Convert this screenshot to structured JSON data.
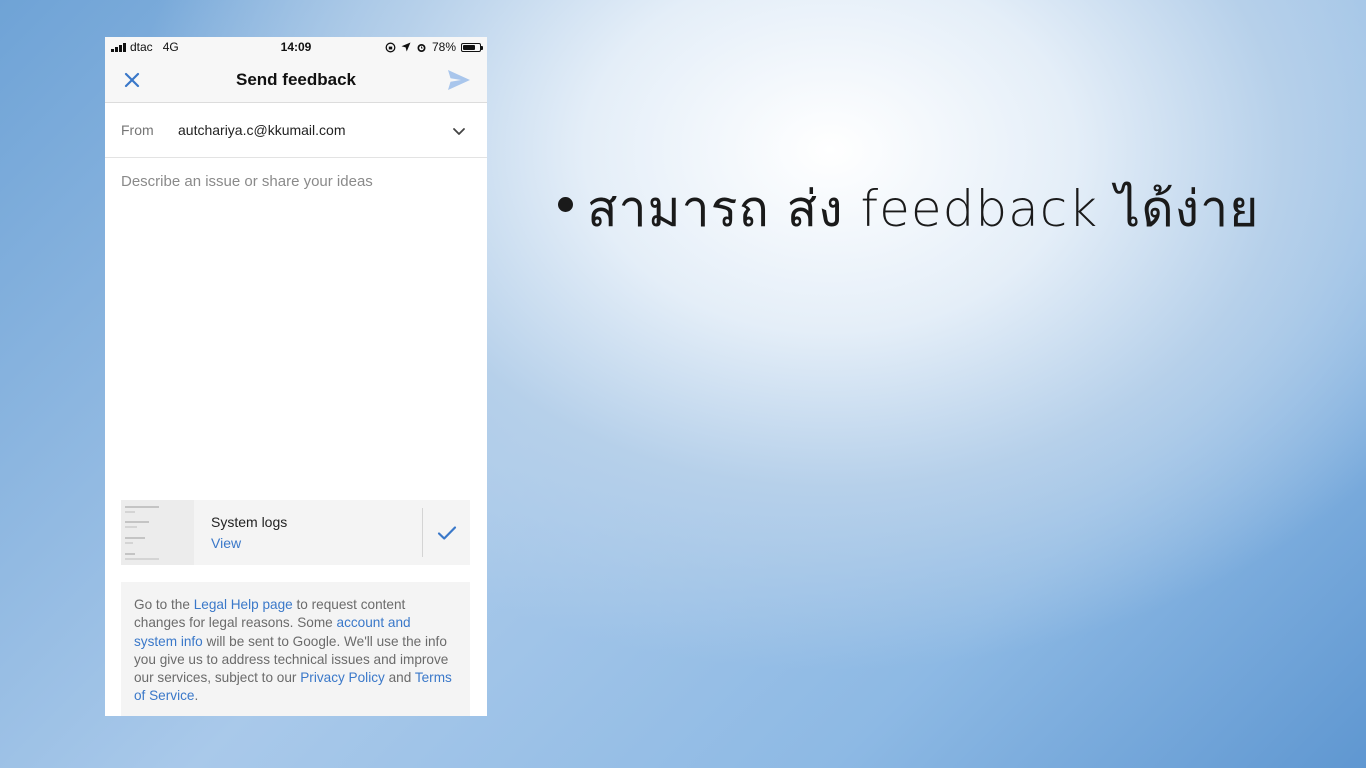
{
  "status_bar": {
    "carrier": "dtac",
    "network": "4G",
    "time": "14:09",
    "battery": "78%",
    "battery_level": 0.78
  },
  "header": {
    "title": "Send feedback",
    "close_icon": "close-icon",
    "send_icon": "send-icon"
  },
  "from": {
    "label": "From",
    "value": "autchariya.c@kkumail.com"
  },
  "description": {
    "placeholder": "Describe an issue or share your ideas"
  },
  "system_logs": {
    "title": "System logs",
    "view_label": "View"
  },
  "legal": {
    "t1": "Go to the ",
    "link_legal_help": "Legal Help page",
    "t2": " to request content changes for legal reasons. Some ",
    "link_account_info": "account and system info",
    "t3": " will be sent to Google. We'll use the info you give us to address technical issues and improve our services, subject to our ",
    "link_privacy": "Privacy Policy",
    "t4": " and ",
    "link_terms": "Terms of Service",
    "t5": "."
  },
  "slide": {
    "bullet": "สามารถ ส่ง feedback ได้ง่าย"
  },
  "colors": {
    "accent": "#3a78c9",
    "send_icon": "#a9c6ec"
  }
}
